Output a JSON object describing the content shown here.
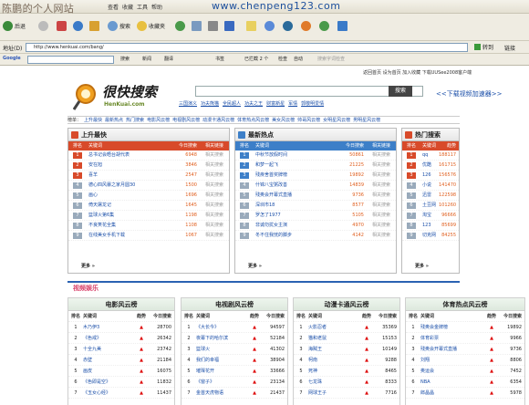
{
  "title": {
    "text": "陈鹏的个人网站",
    "watermark": "www.chenpeng123.com",
    "menu": [
      "查看",
      "收藏",
      "工具",
      "帮助"
    ]
  },
  "toolbar": {
    "back": "后退",
    "search": "搜索",
    "favorites": "收藏夹"
  },
  "address": {
    "label": "地址(D)",
    "url": "http://www.henkuai.com/bang/",
    "go": "转到",
    "links": "链接"
  },
  "google": {
    "label": "Google",
    "items": [
      "搜索",
      "新闻",
      "翻译",
      "书签",
      "已拦截 2 个",
      "检查",
      "自动"
    ],
    "placeholder": "搜索字词检查"
  },
  "page": {
    "topright": "返回首页 设为首页 加入收藏 下载UUSee2008客户端",
    "logo": {
      "cn": "很快搜索",
      "en": "HenKuai.com"
    },
    "search_btn": "搜索",
    "download_link": "<<下载视频加速器>>",
    "tags": [
      "三国演义",
      "功夫熊猫",
      "全民超人",
      "功夫之王",
      "财富新星",
      "军情",
      "郭敬明爱情"
    ],
    "cats": [
      "榜单：",
      "上升最快",
      "最新热点",
      "热门搜索",
      "电影风云榜",
      "电视剧风云榜",
      "动漫卡通风云榜",
      "体育热点风云榜",
      "美女风云榜",
      "帅哥风云榜",
      "女明星风云榜",
      "男明星风云榜"
    ],
    "more": "更多 »",
    "cols": {
      "rank": "排名",
      "kw": "关键词",
      "today": "今日搜索",
      "rel": "相关链接",
      "trend": "趋势"
    },
    "relv": "相关搜索",
    "panels": [
      {
        "title": "上升最快",
        "color": "#d84a2a",
        "rows": [
          [
            "1",
            "总书记会晤台胡代表",
            "6948"
          ],
          [
            "2",
            "安在旭",
            "3846"
          ],
          [
            "3",
            "喜羊",
            "2547"
          ],
          [
            "4",
            "德心四风暴之家月圆30",
            "1500"
          ],
          [
            "5",
            "画心",
            "1696"
          ],
          [
            "6",
            "倚天屠龙记",
            "1645"
          ],
          [
            "7",
            "篮球火第6集",
            "1198"
          ],
          [
            "8",
            "不良笑花全集",
            "1108"
          ],
          [
            "9",
            "在线美女手机下载",
            "1067"
          ]
        ]
      },
      {
        "title": "最新热点",
        "color": "#3d7fc8",
        "rows": [
          [
            "1",
            "中秋节放假时间",
            "50861"
          ],
          [
            "2",
            "和梦一起飞",
            "21225"
          ],
          [
            "3",
            "残疾舍首奖牌榜",
            "19892"
          ],
          [
            "4",
            "什锦八宝粥改善",
            "14839"
          ],
          [
            "5",
            "残奥会开幕式直播",
            "9736"
          ],
          [
            "6",
            "深圳市18",
            "8577"
          ],
          [
            "7",
            "罗怎了1977",
            "5105"
          ],
          [
            "8",
            "非诚勿扰女主演",
            "4970"
          ],
          [
            "9",
            "冬不住我恍的脚步",
            "4142"
          ]
        ]
      },
      {
        "title": "热门搜索",
        "color": "#d84a2a",
        "rows": [
          [
            "1",
            "qq",
            "188117"
          ],
          [
            "2",
            "优酷",
            "161715"
          ],
          [
            "3",
            "126",
            "156576"
          ],
          [
            "4",
            "小说",
            "141470"
          ],
          [
            "5",
            "迅雷",
            "122598"
          ],
          [
            "6",
            "土豆网",
            "101260"
          ],
          [
            "7",
            "淘宝",
            "96666"
          ],
          [
            "8",
            "123",
            "85699"
          ],
          [
            "9",
            "切克网",
            "84255"
          ]
        ]
      }
    ],
    "section": "视频娱乐",
    "charts": [
      {
        "title": "电影风云榜",
        "rows": [
          [
            "1",
            "木乃伊3",
            "28700"
          ],
          [
            "2",
            "《色戒》",
            "26342"
          ],
          [
            "3",
            "十全九美",
            "23742"
          ],
          [
            "4",
            "赤壁",
            "21184"
          ],
          [
            "5",
            "画皮",
            "16075"
          ],
          [
            "6",
            "《色即是空》",
            "11832"
          ],
          [
            "7",
            "《玉女心经》",
            "11437"
          ]
        ]
      },
      {
        "title": "电视剧风云榜",
        "rows": [
          [
            "1",
            "《大长今》",
            "94597"
          ],
          [
            "2",
            "夜幕下的哈尔滨",
            "52184"
          ],
          [
            "3",
            "篮球火",
            "41302"
          ],
          [
            "4",
            "我们的幸福",
            "38904"
          ],
          [
            "5",
            "璀璨花开",
            "33666"
          ],
          [
            "6",
            "《窗子》",
            "23134"
          ],
          [
            "7",
            "金首天虎物语",
            "21437"
          ]
        ]
      },
      {
        "title": "动漫卡通风云榜",
        "rows": [
          [
            "1",
            "火影忍者",
            "35369"
          ],
          [
            "2",
            "猫和老鼠",
            "15153"
          ],
          [
            "3",
            "海贼王",
            "10149"
          ],
          [
            "4",
            "柯南",
            "9288"
          ],
          [
            "5",
            "死神",
            "8465"
          ],
          [
            "6",
            "七龙珠",
            "8333"
          ],
          [
            "7",
            "网球王子",
            "7716"
          ]
        ]
      },
      {
        "title": "体育热点风云榜",
        "rows": [
          [
            "1",
            "残奥会金牌榜",
            "19892"
          ],
          [
            "2",
            "体育彩票",
            "9966"
          ],
          [
            "3",
            "残奥会开幕式直播",
            "9736"
          ],
          [
            "4",
            "刘翔",
            "8806"
          ],
          [
            "5",
            "奥运会",
            "7452"
          ],
          [
            "6",
            "NBA",
            "6354"
          ],
          [
            "7",
            "郎晶晶",
            "5978"
          ]
        ]
      }
    ]
  }
}
